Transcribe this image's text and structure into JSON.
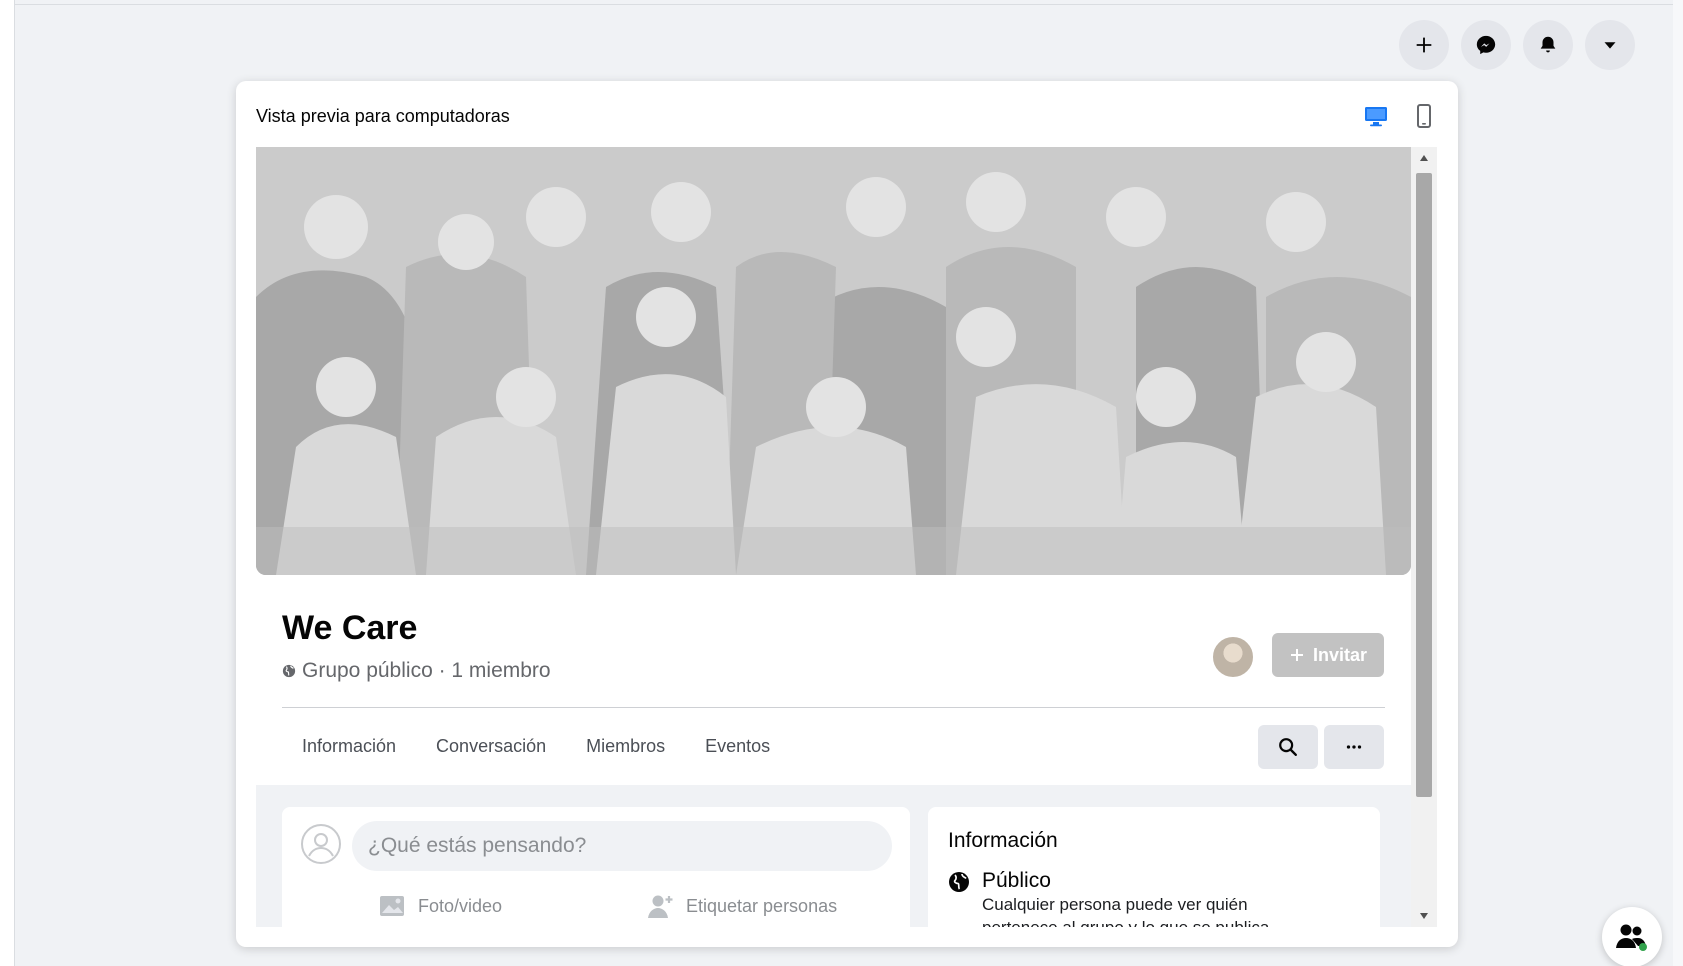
{
  "preview": {
    "title": "Vista previa para computadoras",
    "desktop_icon": "monitor-icon",
    "mobile_icon": "phone-icon"
  },
  "top_actions": [
    {
      "icon": "plus-icon"
    },
    {
      "icon": "messenger-icon"
    },
    {
      "icon": "bell-icon"
    },
    {
      "icon": "caret-down-icon"
    }
  ],
  "group": {
    "name": "We Care",
    "meta": "Grupo público · 1 miembro",
    "invite_label": "Invitar"
  },
  "tabs": [
    "Información",
    "Conversación",
    "Miembros",
    "Eventos"
  ],
  "composer": {
    "placeholder": "¿Qué estás pensando?",
    "photo_label": "Foto/video",
    "tag_label": "Etiquetar personas"
  },
  "info": {
    "title": "Información",
    "privacy_label": "Público",
    "privacy_desc": "Cualquier persona puede ver quién pertenece al grupo y lo que se publica."
  },
  "colors": {
    "accent": "#1877f2",
    "background": "#f0f2f5",
    "cover": "#c8c8c8"
  }
}
